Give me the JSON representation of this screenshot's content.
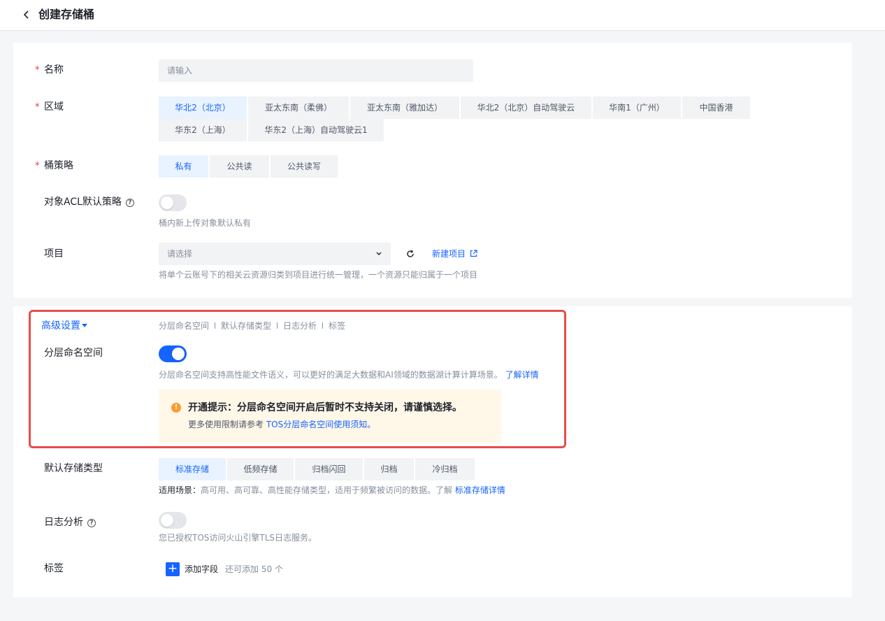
{
  "header": {
    "title": "创建存储桶"
  },
  "name": {
    "label": "名称",
    "placeholder": "请输入"
  },
  "region": {
    "label": "区域",
    "options": [
      "华北2（北京）",
      "亚太东南（柔佛）",
      "亚太东南（雅加达）",
      "华北2（北京）自动驾驶云",
      "华南1（广州）",
      "中国香港",
      "华东2（上海）",
      "华东2（上海）自动驾驶云1"
    ],
    "selected": "华北2（北京）"
  },
  "policy": {
    "label": "桶策略",
    "options": [
      "私有",
      "公共读",
      "公共读写"
    ],
    "selected": "私有"
  },
  "acl": {
    "label": "对象ACL默认策略",
    "help": "?",
    "enabled": false,
    "hint": "桶内新上传对象默认私有"
  },
  "project": {
    "label": "项目",
    "placeholder": "请选择",
    "new_link": "新建项目",
    "hint": "将单个云账号下的相关云资源归类到项目进行统一管理，一个资源只能归属于一个项目"
  },
  "advanced": {
    "title": "高级设置",
    "tabs": [
      "分层命名空间",
      "默认存储类型",
      "日志分析",
      "标签"
    ]
  },
  "hns": {
    "label": "分层命名空间",
    "enabled": true,
    "hint": "分层命名空间支持高性能文件语义，可以更好的满足大数据和AI领域的数据湖计算计算场景。",
    "detail_link": "了解详情",
    "alert_title": "开通提示：分层命名空间开启后暂时不支持关闭，请谨慎选择。",
    "alert_prefix": "更多使用限制请参考 ",
    "alert_link": "TOS分层命名空间使用须知。"
  },
  "storage": {
    "label": "默认存储类型",
    "options": [
      "标准存储",
      "低频存储",
      "归档闪回",
      "归档",
      "冷归档"
    ],
    "selected": "标准存储",
    "scene_label": "适用场景：",
    "scene_text": "高可用、高可靠、高性能存储类型，适用于频繁被访问的数据。了解 ",
    "scene_link": "标准存储详情"
  },
  "log": {
    "label": "日志分析",
    "help": "?",
    "enabled": false,
    "hint": "您已授权TOS访问火山引擎TLS日志服务。"
  },
  "tags": {
    "label": "标签",
    "add_label": "添加字段",
    "remaining": "还可添加 50 个"
  },
  "colors": {
    "accent": "#1664ff",
    "highlight_border": "#e84c4c",
    "required": "#e53e3e",
    "alert_bg": "#fff7e8"
  }
}
